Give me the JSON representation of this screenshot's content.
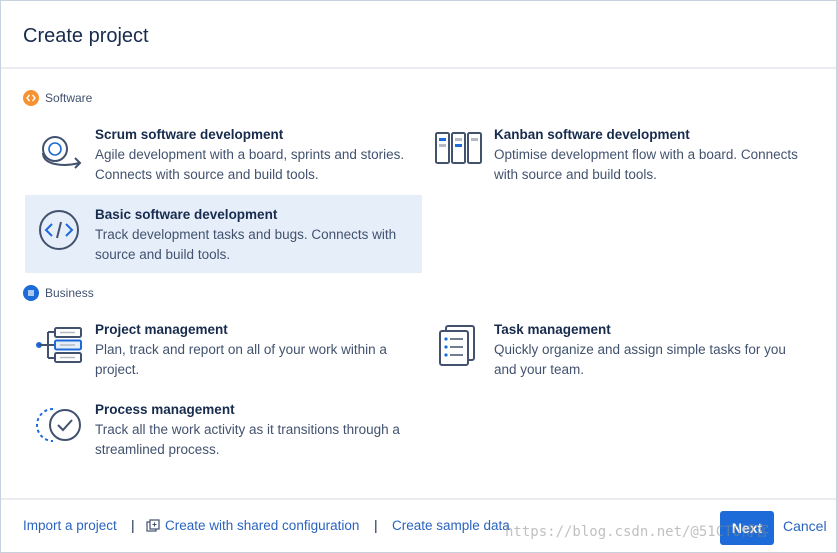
{
  "dialog": {
    "title": "Create project"
  },
  "sections": {
    "software": {
      "label": "Software",
      "icon": "code-icon",
      "color": "#f79232"
    },
    "business": {
      "label": "Business",
      "icon": "list-icon",
      "color": "#1c6bd8"
    }
  },
  "templates": {
    "scrum": {
      "title": "Scrum software development",
      "desc1": "Agile development with a board, sprints and stories.",
      "desc2": "Connects with source and build tools.",
      "icon": "scrum-cycle-icon"
    },
    "kanban": {
      "title": "Kanban software development",
      "desc1": "Optimise development flow with a board. Connects",
      "desc2": "with source and build tools.",
      "icon": "kanban-board-icon"
    },
    "basic": {
      "title": "Basic software development",
      "desc1": "Track development tasks and bugs. Connects with",
      "desc2": "source and build tools.",
      "icon": "code-brackets-icon",
      "selected": true
    },
    "project_management": {
      "title": "Project management",
      "desc1": "Plan, track and report on all of your work within a",
      "desc2": "project.",
      "icon": "project-stack-icon"
    },
    "task_management": {
      "title": "Task management",
      "desc1": "Quickly organize and assign simple tasks for you",
      "desc2": "and your team.",
      "icon": "task-list-icon"
    },
    "process_management": {
      "title": "Process management",
      "desc1": "Track all the work activity as it transitions through a",
      "desc2": "streamlined process.",
      "icon": "process-check-icon"
    }
  },
  "footer": {
    "import_label": "Import a project",
    "shared_config_label": "Create with shared configuration",
    "sample_data_label": "Create sample data",
    "separator": "|",
    "next_label": "Next",
    "cancel_label": "Cancel"
  },
  "watermark": "https://blog.csdn.net/@51CTO博客",
  "colors": {
    "accent": "#1c6bd8",
    "selected_bg": "#e6eefa",
    "link": "#2a64c0",
    "text": "#172b4d",
    "muted": "#42526e"
  }
}
